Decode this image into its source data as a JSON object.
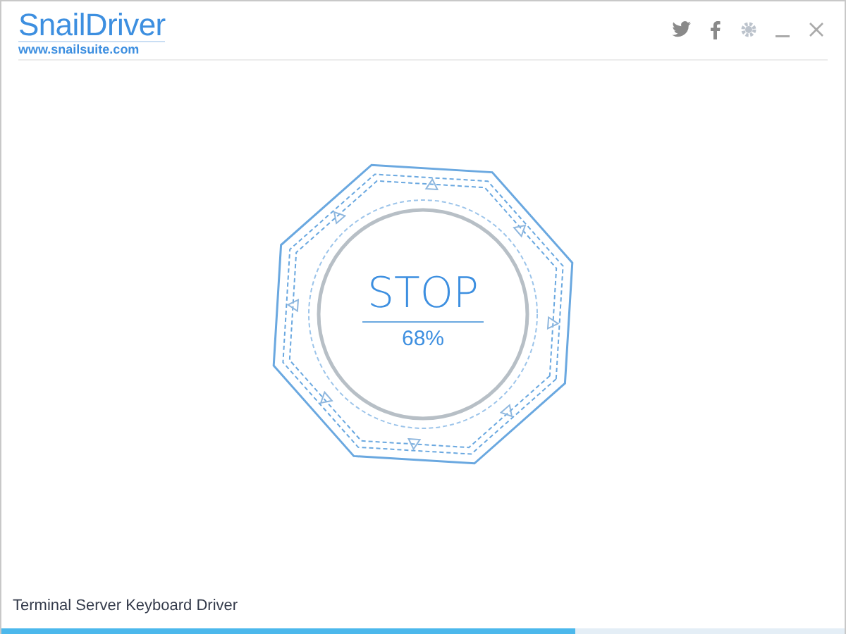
{
  "logo": {
    "title": "SnailDriver",
    "url": "www.snailsuite.com"
  },
  "toolbar": [
    {
      "kind": "twitter"
    },
    {
      "kind": "facebook"
    },
    {
      "kind": "settings"
    },
    {
      "kind": "minimize"
    },
    {
      "kind": "close"
    }
  ],
  "scan": {
    "button": "STOP",
    "percent": "68%"
  },
  "status": {
    "current_item": "Terminal Server Keyboard Driver"
  },
  "progress": {
    "level": 0.68
  }
}
